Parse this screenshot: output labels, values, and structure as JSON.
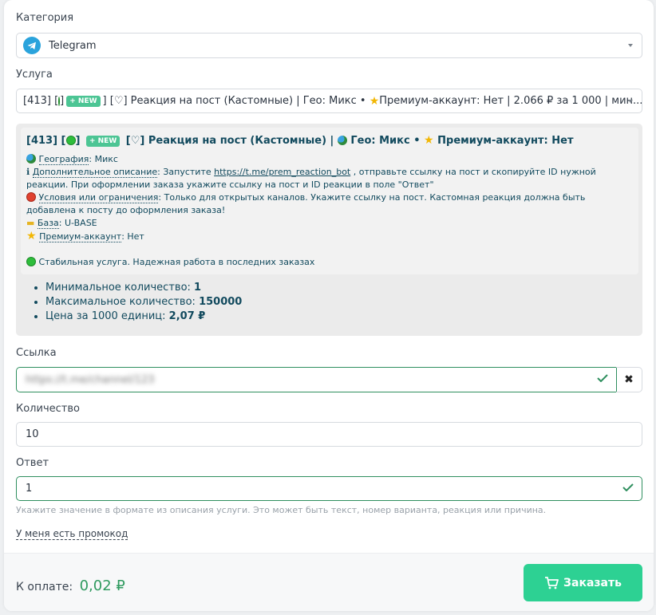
{
  "category": {
    "label": "Категория",
    "value": "Telegram"
  },
  "service": {
    "label": "Услуга",
    "value_prefix": "[413] [",
    "value_suffix": "] [♡] Реакция на пост (Кастомные) | ",
    "value_geo": "Гео: Микс • ",
    "value_rest": "Премиум-аккаунт: Нет | 2.066 ₽ за 1 000 | мин...",
    "new_badge": "+ NEW"
  },
  "details": {
    "title_prefix": "[413] [",
    "title_mid": "] ",
    "title_main": "[♡] Реакция на пост (Кастомные) | ",
    "title_geo": "Гео: Микс • ",
    "title_premium": "Премиум-аккаунт: Нет",
    "geo_label": "География",
    "geo_value": ": Микс",
    "desc_label": "Дополнительное описание",
    "desc_pre": ": Запустите ",
    "desc_link": "https://t.me/prem_reaction_bot",
    "desc_post": " , отправьте ссылку на пост и скопируйте ID нужной реакции. При оформлении заказа укажите ссылку на пост и ID реакции в поле \"Ответ\"",
    "cond_label": "Условия или ограничения",
    "cond_value": ": Только для открытых каналов. Укажите ссылку на пост. Кастомная реакция должна быть добавлена к посту до оформления заказа!",
    "base_label": "База",
    "base_value": ": U-BASE",
    "premium_label": "Премиум-аккаунт",
    "premium_value": ": Нет",
    "stable": "Стабильная услуга. Надежная работа в последних заказах"
  },
  "stats": {
    "min_label": "Минимальное количество: ",
    "min_value": "1",
    "max_label": "Максимальное количество: ",
    "max_value": "150000",
    "price_label": "Цена за 1000 единиц: ",
    "price_value": "2,07 ₽"
  },
  "link_field": {
    "label": "Ссылка",
    "value": "https://t.me/channel/123",
    "clear_icon": "✖"
  },
  "quantity_field": {
    "label": "Количество",
    "value": "10"
  },
  "answer_field": {
    "label": "Ответ",
    "value": "1",
    "hint": "Укажите значение в формате из описания услуги. Это может быть текст, номер варианта, реакция или причина."
  },
  "promo": "У меня есть промокод",
  "footer": {
    "pay_label": "К оплате:",
    "pay_value": "0,02 ₽",
    "order_label": "Заказать"
  },
  "colors": {
    "accent": "#2dd193",
    "valid_border": "#2f8f5f",
    "info_text": "#124a5e"
  }
}
